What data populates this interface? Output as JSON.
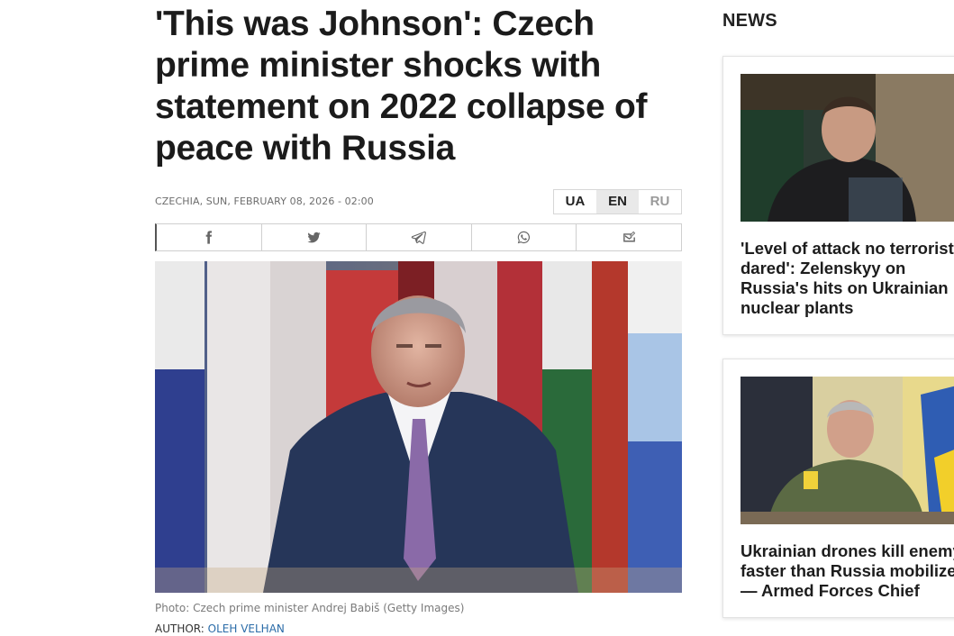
{
  "article": {
    "headline": "'This was Johnson': Czech prime minister shocks with statement on 2022 collapse of peace with Russia",
    "dateline": "CZECHIA, SUN, FEBRUARY 08, 2026 - 02:00",
    "languages": [
      "UA",
      "EN",
      "RU"
    ],
    "active_language": "EN",
    "share_icons": [
      "facebook-icon",
      "twitter-icon",
      "telegram-icon",
      "whatsapp-icon",
      "email-icon"
    ],
    "caption": "Photo: Czech prime minister Andrej Babiš (Getty Images)",
    "author_label": "AUTHOR:",
    "author_name": "OLEH VELHAN"
  },
  "sidebar": {
    "title": "NEWS",
    "items": [
      {
        "headline": "'Level of attack no terrorist dared': Zelenskyy on Russia's hits on Ukrainian nuclear plants"
      },
      {
        "headline": "Ukrainian drones kill enemy faster than Russia mobilizes — Armed Forces Chief"
      }
    ]
  },
  "colors": {
    "link": "#2b6ca8",
    "active_lang_bg": "#e9e9e9",
    "text": "#1a1a1a"
  }
}
